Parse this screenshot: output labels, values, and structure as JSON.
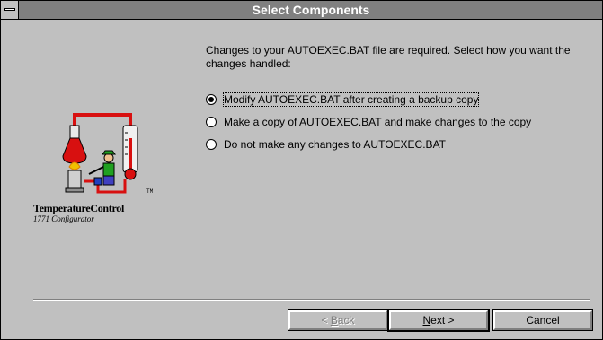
{
  "window": {
    "title": "Select Components"
  },
  "message": "Changes to your AUTOEXEC.BAT file are required.  Select how you want the changes handled:",
  "options": [
    {
      "label": "Modify AUTOEXEC.BAT after creating a backup copy",
      "selected": true
    },
    {
      "label": "Make a copy of AUTOEXEC.BAT and make changes to the copy",
      "selected": false
    },
    {
      "label": "Do not make any changes to AUTOEXEC.BAT",
      "selected": false
    }
  ],
  "logo": {
    "trademark": "TM",
    "name": "TemperatureControl",
    "subtitle": "1771 Configurator"
  },
  "buttons": {
    "back": {
      "prefix": "< ",
      "accel": "B",
      "rest": "ack"
    },
    "next": {
      "accel": "N",
      "rest": "ext >"
    },
    "cancel": "Cancel"
  },
  "colors": {
    "titlebar": "#808080",
    "background": "#c0c0c0",
    "thermometer": "#d81010",
    "flask": "#d81010"
  }
}
